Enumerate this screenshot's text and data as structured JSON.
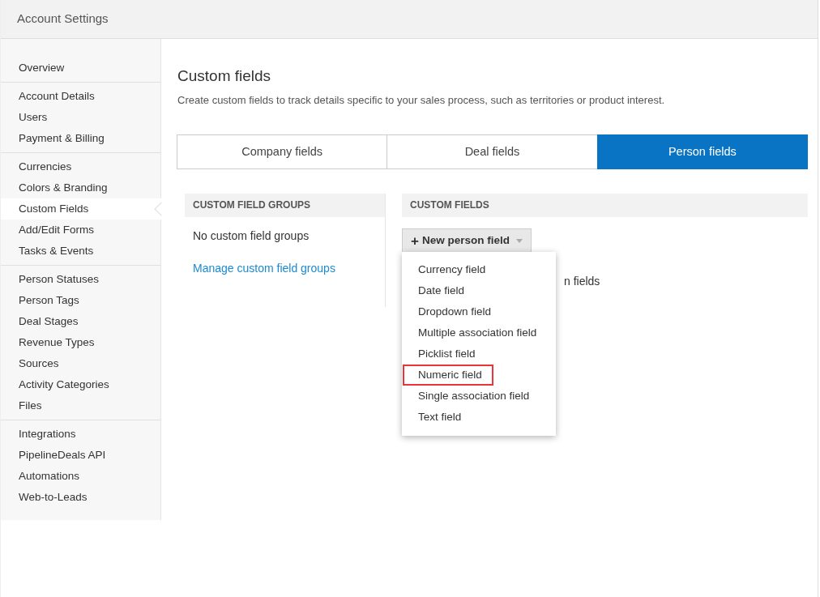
{
  "header": {
    "title": "Account Settings"
  },
  "sidebar": {
    "groups": [
      {
        "items": [
          {
            "label": "Overview",
            "selected": false
          }
        ]
      },
      {
        "items": [
          {
            "label": "Account Details",
            "selected": false
          },
          {
            "label": "Users",
            "selected": false
          },
          {
            "label": "Payment & Billing",
            "selected": false
          }
        ]
      },
      {
        "items": [
          {
            "label": "Currencies",
            "selected": false
          },
          {
            "label": "Colors & Branding",
            "selected": false
          },
          {
            "label": "Custom Fields",
            "selected": true
          },
          {
            "label": "Add/Edit Forms",
            "selected": false
          },
          {
            "label": "Tasks & Events",
            "selected": false
          }
        ]
      },
      {
        "items": [
          {
            "label": "Person Statuses",
            "selected": false
          },
          {
            "label": "Person Tags",
            "selected": false
          },
          {
            "label": "Deal Stages",
            "selected": false
          },
          {
            "label": "Revenue Types",
            "selected": false
          },
          {
            "label": "Sources",
            "selected": false
          },
          {
            "label": "Activity Categories",
            "selected": false
          },
          {
            "label": "Files",
            "selected": false
          }
        ]
      },
      {
        "items": [
          {
            "label": "Integrations",
            "selected": false
          },
          {
            "label": "PipelineDeals API",
            "selected": false
          },
          {
            "label": "Automations",
            "selected": false
          },
          {
            "label": "Web-to-Leads",
            "selected": false
          }
        ]
      }
    ]
  },
  "page": {
    "title": "Custom fields",
    "description": "Create custom fields to track details specific to your sales process, such as territories or product interest."
  },
  "tabs": [
    {
      "label": "Company fields",
      "selected": false
    },
    {
      "label": "Deal fields",
      "selected": false
    },
    {
      "label": "Person fields",
      "selected": true
    }
  ],
  "groups_panel": {
    "heading": "CUSTOM FIELD GROUPS",
    "empty_text": "No custom field groups",
    "link": "Manage custom field groups"
  },
  "fields_panel": {
    "heading": "CUSTOM FIELDS",
    "button": {
      "icon": "+",
      "label": "New person field",
      "expanded": true
    },
    "covered_text": "n fields",
    "menu": [
      {
        "label": "Currency field",
        "highlighted": false
      },
      {
        "label": "Date field",
        "highlighted": false
      },
      {
        "label": "Dropdown field",
        "highlighted": false
      },
      {
        "label": "Multiple association field",
        "highlighted": false
      },
      {
        "label": "Picklist field",
        "highlighted": false
      },
      {
        "label": "Numeric field",
        "highlighted": true
      },
      {
        "label": "Single association field",
        "highlighted": false
      },
      {
        "label": "Text field",
        "highlighted": false
      }
    ]
  }
}
